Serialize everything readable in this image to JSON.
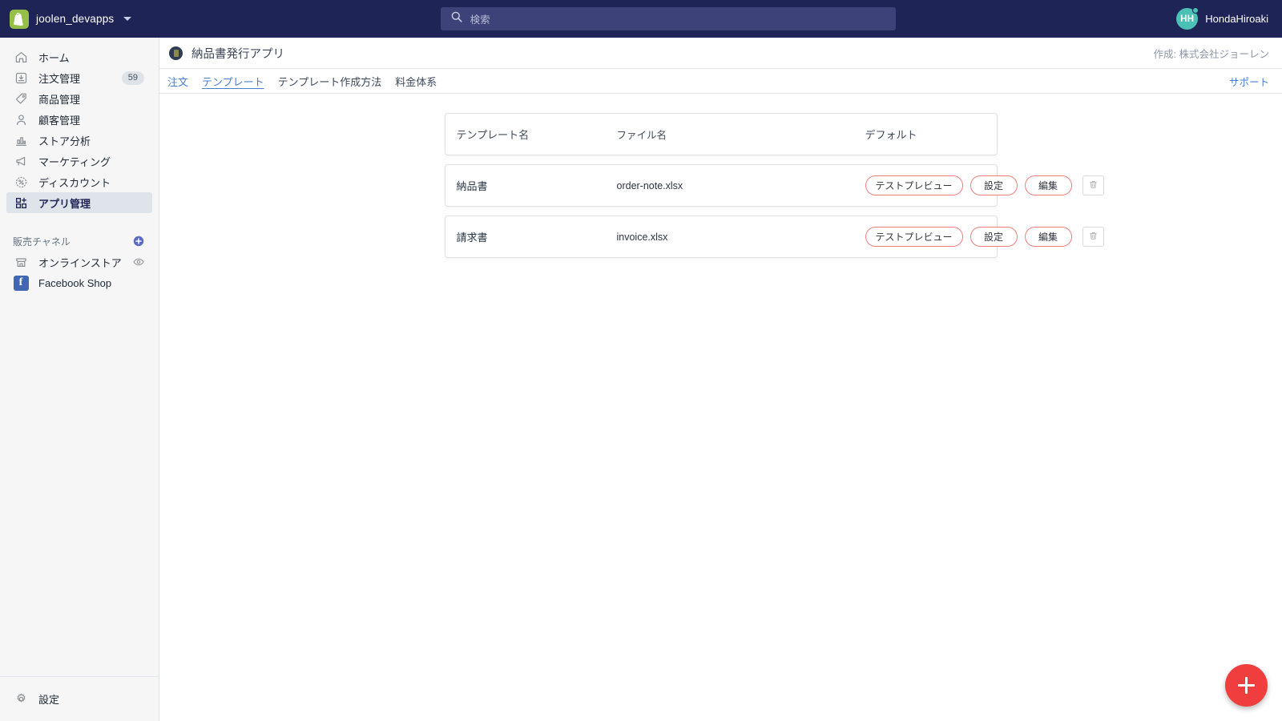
{
  "topbar": {
    "store_name": "joolen_devapps",
    "store_menu_icon": "caret-down-icon",
    "shop_logo_icon": "shopify-bag-icon",
    "search": {
      "placeholder": "検索",
      "value": "",
      "icon": "search-icon"
    },
    "user": {
      "initials": "HH",
      "name": "HondaHiroaki"
    },
    "colors": {
      "bar_bg": "#1f2457",
      "search_bg": "#3d4278",
      "avatar_bg": "#4bc0b5",
      "logo_bg": "#95bf47"
    }
  },
  "sidebar": {
    "items": [
      {
        "label": "ホーム",
        "icon": "home-icon",
        "badge": "",
        "active": false
      },
      {
        "label": "注文管理",
        "icon": "orders-inbox-icon",
        "badge": "59",
        "active": false
      },
      {
        "label": "商品管理",
        "icon": "tag-icon",
        "badge": "",
        "active": false
      },
      {
        "label": "顧客管理",
        "icon": "person-icon",
        "badge": "",
        "active": false
      },
      {
        "label": "ストア分析",
        "icon": "bar-chart-icon",
        "badge": "",
        "active": false
      },
      {
        "label": "マーケティング",
        "icon": "megaphone-icon",
        "badge": "",
        "active": false
      },
      {
        "label": "ディスカウント",
        "icon": "discount-percent-icon",
        "badge": "",
        "active": false
      },
      {
        "label": "アプリ管理",
        "icon": "apps-grid-icon",
        "badge": "",
        "active": true
      }
    ],
    "channels": {
      "title": "販売チャネル",
      "add_icon": "plus-circle-icon",
      "items": [
        {
          "label": "オンラインストア",
          "icon": "storefront-icon",
          "trailing_icon": "eye-icon"
        },
        {
          "label": "Facebook Shop",
          "icon": "facebook-icon",
          "trailing_icon": ""
        }
      ]
    },
    "settings": {
      "label": "設定",
      "icon": "gear-icon"
    },
    "colors": {
      "bg": "#f6f6f7",
      "active_bg": "#dfe3ea"
    }
  },
  "app_header": {
    "icon": "app-circle-icon",
    "title": "納品書発行アプリ",
    "author": "作成: 株式会社ジョーレン"
  },
  "tabbar": {
    "tabs": [
      {
        "label": "注文",
        "active": false,
        "style": "link"
      },
      {
        "label": "テンプレート",
        "active": true,
        "style": "link"
      },
      {
        "label": "テンプレート作成方法",
        "active": false,
        "style": "dark"
      },
      {
        "label": "料金体系",
        "active": false,
        "style": "dark"
      }
    ],
    "support_label": "サポート"
  },
  "table": {
    "headers": {
      "name": "テンプレート名",
      "file": "ファイル名",
      "default": "デフォルト"
    },
    "rows": [
      {
        "name": "納品書",
        "file": "order-note.xlsx",
        "default": "",
        "actions": {
          "preview": "テストプレビュー",
          "config": "設定",
          "edit": "編集",
          "delete_icon": "trash-icon"
        }
      },
      {
        "name": "請求書",
        "file": "invoice.xlsx",
        "default": "",
        "actions": {
          "preview": "テストプレビュー",
          "config": "設定",
          "edit": "編集",
          "delete_icon": "trash-icon"
        }
      }
    ],
    "button_border_color": "#ef7f7f"
  },
  "fab": {
    "icon": "plus-icon",
    "color": "#f03e3e"
  }
}
